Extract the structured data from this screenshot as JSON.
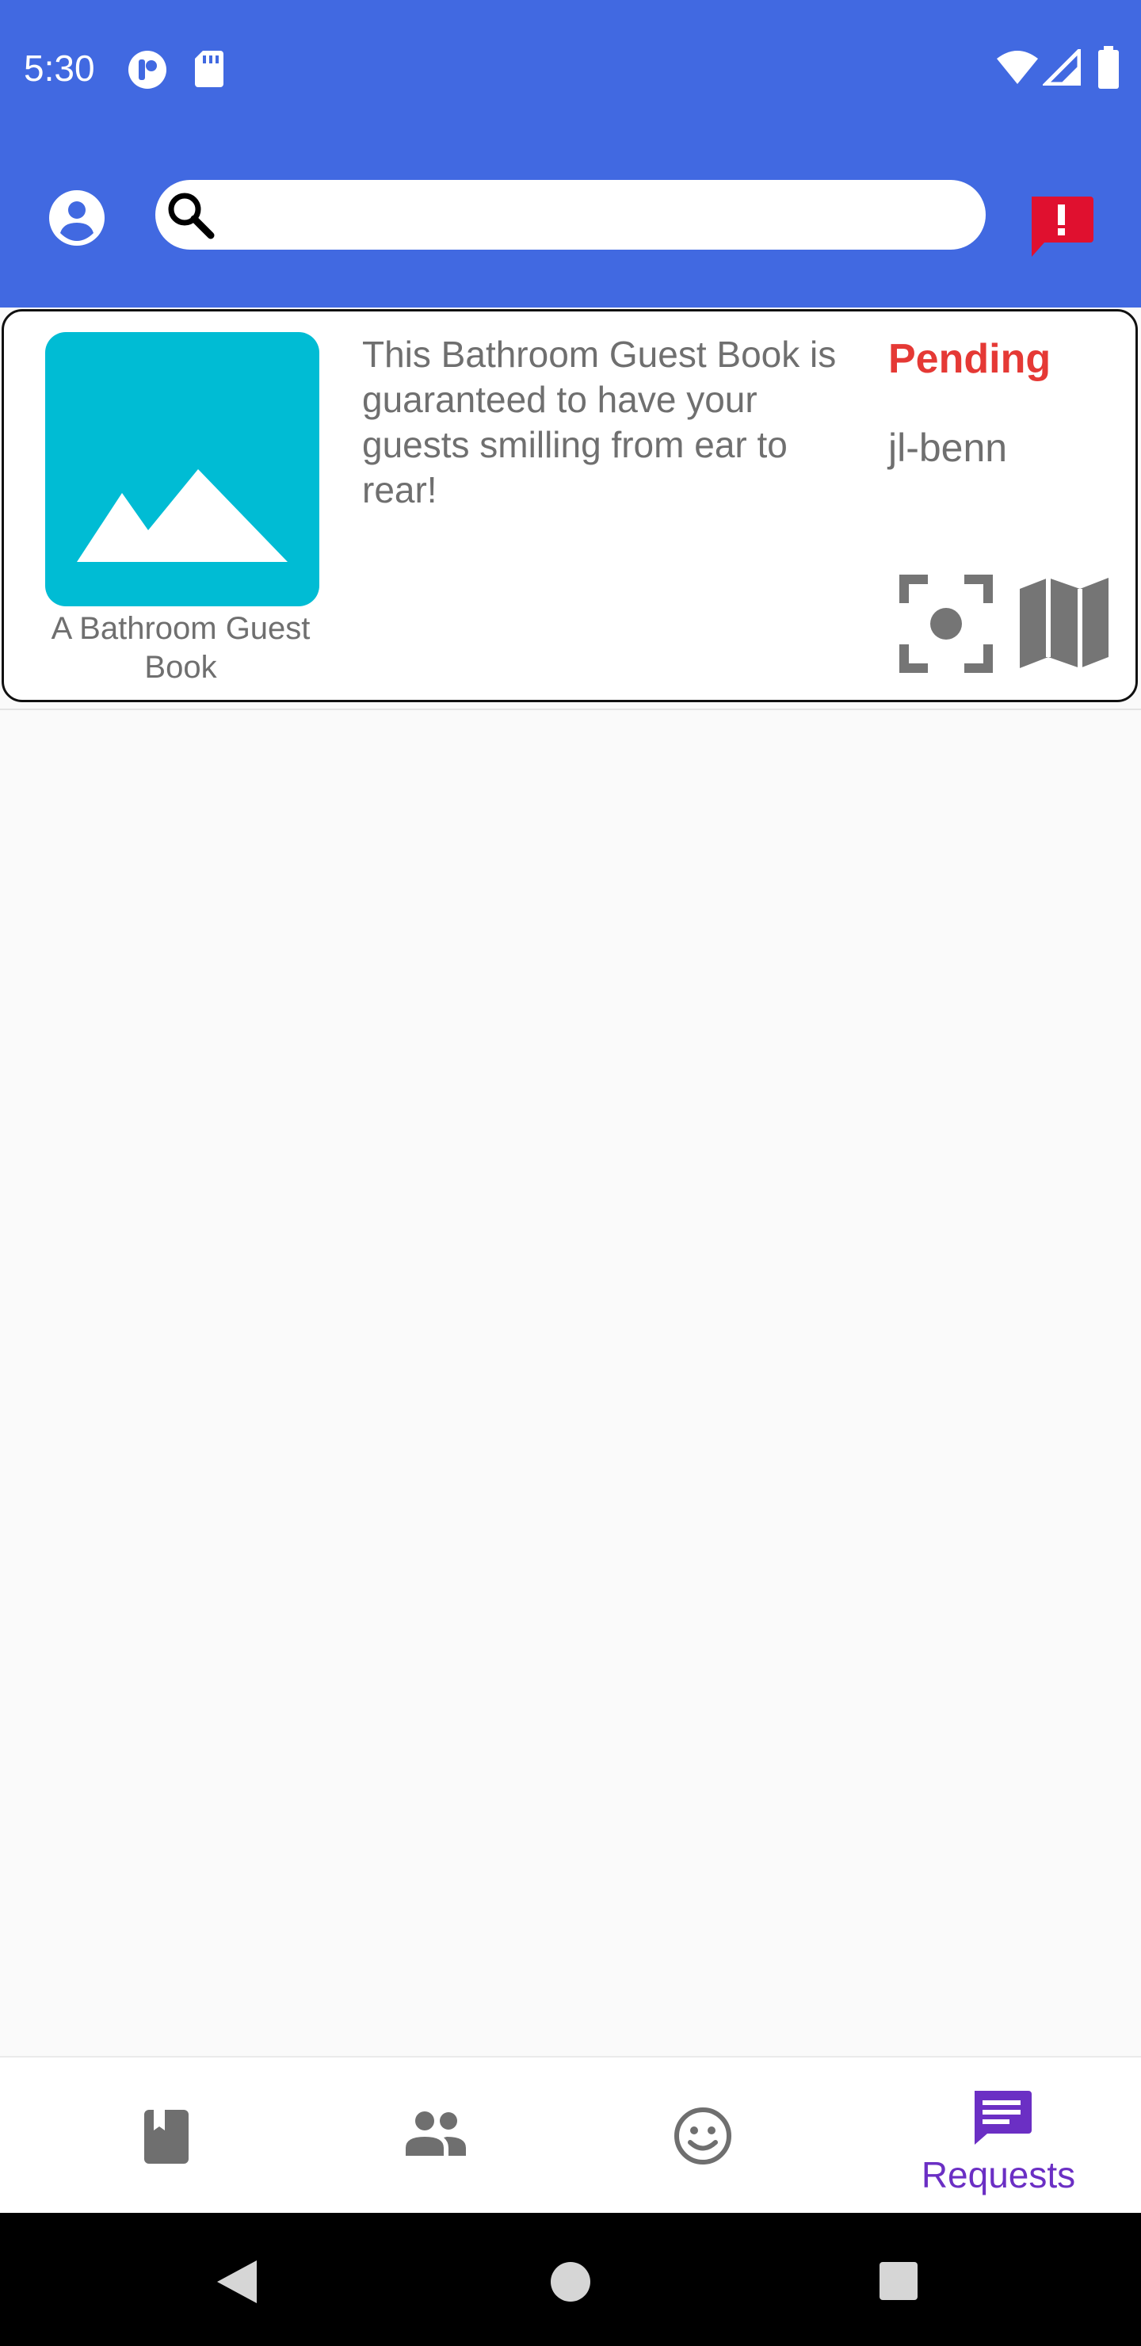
{
  "status_bar": {
    "time": "5:30",
    "left_icons": [
      "app-notification-icon",
      "sd-card-icon"
    ],
    "right_icons": [
      "wifi-icon",
      "signal-icon",
      "battery-icon"
    ]
  },
  "app_bar": {
    "account_icon": "account-circle-icon",
    "search": {
      "value": "",
      "placeholder": "",
      "icon": "search-icon"
    },
    "report_icon": "report-icon",
    "report_color": "#e0102f",
    "background": "#4169e1"
  },
  "requests": [
    {
      "thumbnail_icon": "image-placeholder-icon",
      "thumbnail_color": "#00bcd4",
      "title": "A Bathroom Guest Book",
      "description": "This Bathroom Guest Book is guaranteed to have your guests smilling from ear to rear!",
      "status": "Pending",
      "status_color": "#e53935",
      "owner": "jl-benn",
      "actions": [
        "scan-icon",
        "map-icon"
      ]
    }
  ],
  "bottom_nav": {
    "items": [
      {
        "icon": "book-icon",
        "label": ""
      },
      {
        "icon": "people-icon",
        "label": ""
      },
      {
        "icon": "smiley-icon",
        "label": ""
      },
      {
        "icon": "chat-icon",
        "label": "Requests",
        "active": true
      }
    ],
    "active_color": "#6b2fc4",
    "inactive_color": "#6f6f6f"
  },
  "system_nav": {
    "icons": [
      "back-icon",
      "home-icon",
      "recents-icon"
    ]
  }
}
